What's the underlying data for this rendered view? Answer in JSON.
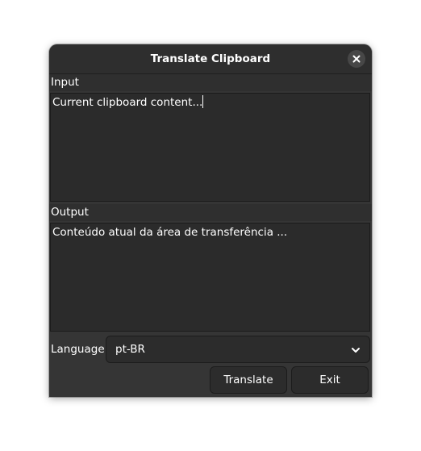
{
  "window": {
    "title": "Translate Clipboard"
  },
  "input": {
    "label": "Input",
    "text": "Current clipboard content..."
  },
  "output": {
    "label": "Output",
    "text": "Conteúdo atual da área de transferência ..."
  },
  "language": {
    "label": "Language",
    "selected": "pt-BR"
  },
  "buttons": {
    "translate": "Translate",
    "exit": "Exit"
  },
  "icons": {
    "close": "close-icon",
    "dropdown": "chevron-down-icon"
  }
}
